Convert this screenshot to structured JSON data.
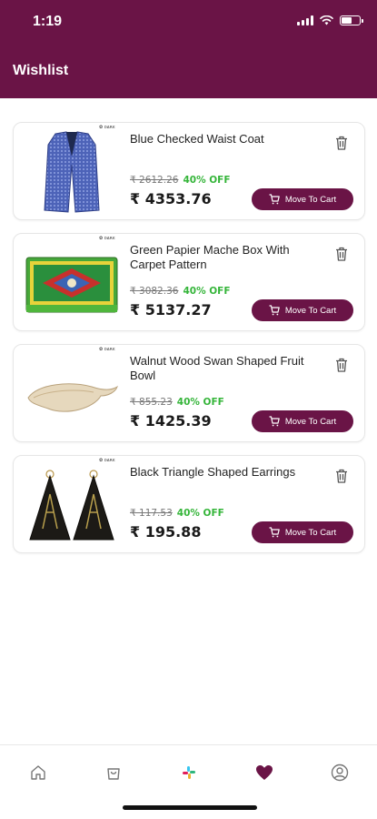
{
  "status_bar": {
    "time": "1:19"
  },
  "header": {
    "title": "Wishlist"
  },
  "colors": {
    "brand": "#6a1446",
    "discount": "#35b53a"
  },
  "items": [
    {
      "name": "Blue Checked Waist Coat",
      "original_price": "₹ 2612.26",
      "discount": "40% OFF",
      "price": "₹ 4353.76",
      "button": "Move To Cart",
      "image": "blue-waist-coat"
    },
    {
      "name": "Green Papier Mache Box With Carpet Pattern",
      "original_price": "₹ 3082.36",
      "discount": "40% OFF",
      "price": "₹ 5137.27",
      "button": "Move To Cart",
      "image": "papier-mache-box"
    },
    {
      "name": "Walnut Wood Swan Shaped Fruit Bowl",
      "original_price": "₹ 855.23",
      "discount": "40% OFF",
      "price": "₹ 1425.39",
      "button": "Move To Cart",
      "image": "swan-fruit-bowl"
    },
    {
      "name": "Black Triangle Shaped Earrings",
      "original_price": "₹ 117.53",
      "discount": "40% OFF",
      "price": "₹ 195.88",
      "button": "Move To Cart",
      "image": "triangle-earrings"
    }
  ],
  "tabs": [
    {
      "icon": "home-icon"
    },
    {
      "icon": "shopping-bag-icon"
    },
    {
      "icon": "slack-logo-icon"
    },
    {
      "icon": "heart-icon",
      "active": true
    },
    {
      "icon": "profile-icon"
    }
  ]
}
